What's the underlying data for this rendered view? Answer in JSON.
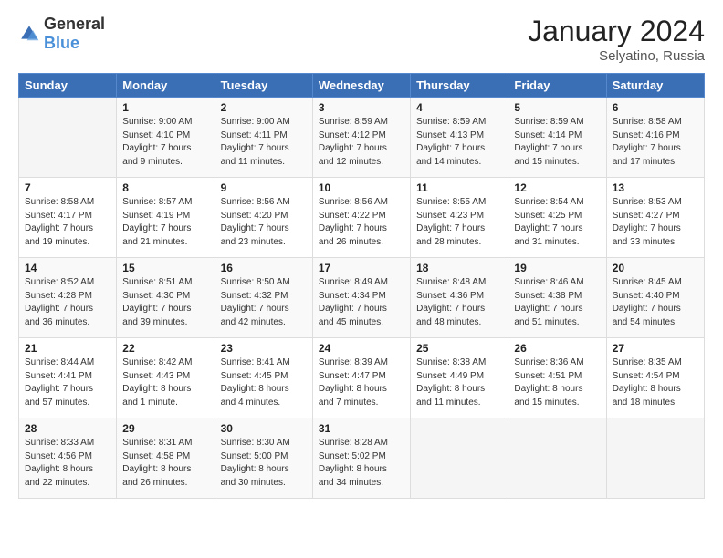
{
  "header": {
    "logo_general": "General",
    "logo_blue": "Blue",
    "title": "January 2024",
    "location": "Selyatino, Russia"
  },
  "days_of_week": [
    "Sunday",
    "Monday",
    "Tuesday",
    "Wednesday",
    "Thursday",
    "Friday",
    "Saturday"
  ],
  "weeks": [
    [
      {
        "day": "",
        "info": ""
      },
      {
        "day": "1",
        "info": "Sunrise: 9:00 AM\nSunset: 4:10 PM\nDaylight: 7 hours\nand 9 minutes."
      },
      {
        "day": "2",
        "info": "Sunrise: 9:00 AM\nSunset: 4:11 PM\nDaylight: 7 hours\nand 11 minutes."
      },
      {
        "day": "3",
        "info": "Sunrise: 8:59 AM\nSunset: 4:12 PM\nDaylight: 7 hours\nand 12 minutes."
      },
      {
        "day": "4",
        "info": "Sunrise: 8:59 AM\nSunset: 4:13 PM\nDaylight: 7 hours\nand 14 minutes."
      },
      {
        "day": "5",
        "info": "Sunrise: 8:59 AM\nSunset: 4:14 PM\nDaylight: 7 hours\nand 15 minutes."
      },
      {
        "day": "6",
        "info": "Sunrise: 8:58 AM\nSunset: 4:16 PM\nDaylight: 7 hours\nand 17 minutes."
      }
    ],
    [
      {
        "day": "7",
        "info": "Sunrise: 8:58 AM\nSunset: 4:17 PM\nDaylight: 7 hours\nand 19 minutes."
      },
      {
        "day": "8",
        "info": "Sunrise: 8:57 AM\nSunset: 4:19 PM\nDaylight: 7 hours\nand 21 minutes."
      },
      {
        "day": "9",
        "info": "Sunrise: 8:56 AM\nSunset: 4:20 PM\nDaylight: 7 hours\nand 23 minutes."
      },
      {
        "day": "10",
        "info": "Sunrise: 8:56 AM\nSunset: 4:22 PM\nDaylight: 7 hours\nand 26 minutes."
      },
      {
        "day": "11",
        "info": "Sunrise: 8:55 AM\nSunset: 4:23 PM\nDaylight: 7 hours\nand 28 minutes."
      },
      {
        "day": "12",
        "info": "Sunrise: 8:54 AM\nSunset: 4:25 PM\nDaylight: 7 hours\nand 31 minutes."
      },
      {
        "day": "13",
        "info": "Sunrise: 8:53 AM\nSunset: 4:27 PM\nDaylight: 7 hours\nand 33 minutes."
      }
    ],
    [
      {
        "day": "14",
        "info": "Sunrise: 8:52 AM\nSunset: 4:28 PM\nDaylight: 7 hours\nand 36 minutes."
      },
      {
        "day": "15",
        "info": "Sunrise: 8:51 AM\nSunset: 4:30 PM\nDaylight: 7 hours\nand 39 minutes."
      },
      {
        "day": "16",
        "info": "Sunrise: 8:50 AM\nSunset: 4:32 PM\nDaylight: 7 hours\nand 42 minutes."
      },
      {
        "day": "17",
        "info": "Sunrise: 8:49 AM\nSunset: 4:34 PM\nDaylight: 7 hours\nand 45 minutes."
      },
      {
        "day": "18",
        "info": "Sunrise: 8:48 AM\nSunset: 4:36 PM\nDaylight: 7 hours\nand 48 minutes."
      },
      {
        "day": "19",
        "info": "Sunrise: 8:46 AM\nSunset: 4:38 PM\nDaylight: 7 hours\nand 51 minutes."
      },
      {
        "day": "20",
        "info": "Sunrise: 8:45 AM\nSunset: 4:40 PM\nDaylight: 7 hours\nand 54 minutes."
      }
    ],
    [
      {
        "day": "21",
        "info": "Sunrise: 8:44 AM\nSunset: 4:41 PM\nDaylight: 7 hours\nand 57 minutes."
      },
      {
        "day": "22",
        "info": "Sunrise: 8:42 AM\nSunset: 4:43 PM\nDaylight: 8 hours\nand 1 minute."
      },
      {
        "day": "23",
        "info": "Sunrise: 8:41 AM\nSunset: 4:45 PM\nDaylight: 8 hours\nand 4 minutes."
      },
      {
        "day": "24",
        "info": "Sunrise: 8:39 AM\nSunset: 4:47 PM\nDaylight: 8 hours\nand 7 minutes."
      },
      {
        "day": "25",
        "info": "Sunrise: 8:38 AM\nSunset: 4:49 PM\nDaylight: 8 hours\nand 11 minutes."
      },
      {
        "day": "26",
        "info": "Sunrise: 8:36 AM\nSunset: 4:51 PM\nDaylight: 8 hours\nand 15 minutes."
      },
      {
        "day": "27",
        "info": "Sunrise: 8:35 AM\nSunset: 4:54 PM\nDaylight: 8 hours\nand 18 minutes."
      }
    ],
    [
      {
        "day": "28",
        "info": "Sunrise: 8:33 AM\nSunset: 4:56 PM\nDaylight: 8 hours\nand 22 minutes."
      },
      {
        "day": "29",
        "info": "Sunrise: 8:31 AM\nSunset: 4:58 PM\nDaylight: 8 hours\nand 26 minutes."
      },
      {
        "day": "30",
        "info": "Sunrise: 8:30 AM\nSunset: 5:00 PM\nDaylight: 8 hours\nand 30 minutes."
      },
      {
        "day": "31",
        "info": "Sunrise: 8:28 AM\nSunset: 5:02 PM\nDaylight: 8 hours\nand 34 minutes."
      },
      {
        "day": "",
        "info": ""
      },
      {
        "day": "",
        "info": ""
      },
      {
        "day": "",
        "info": ""
      }
    ]
  ]
}
